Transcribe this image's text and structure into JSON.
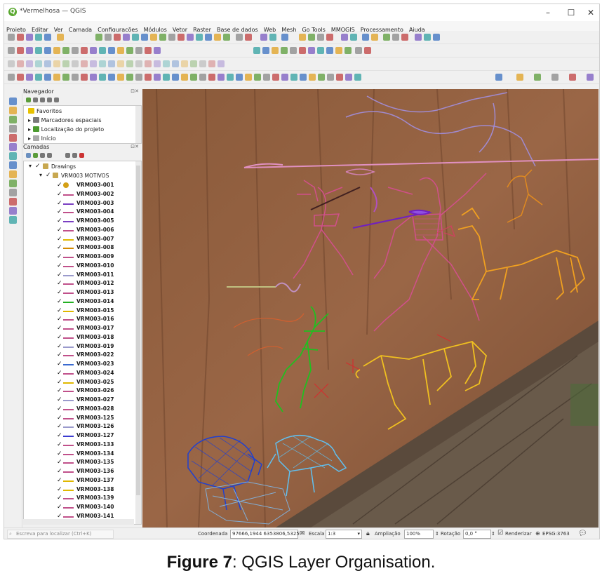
{
  "window": {
    "title": "*Vermelhosa — QGIS",
    "minimize": "–",
    "maximize": "☐",
    "close": "✕"
  },
  "menu": [
    "Projeto",
    "Editar",
    "Ver",
    "Camada",
    "Configurações",
    "Módulos",
    "Vetor",
    "Raster",
    "Base de dados",
    "Web",
    "Mesh",
    "Go Tools",
    "MMQGIS",
    "Processamento",
    "Ajuda"
  ],
  "navigator": {
    "title": "Navegador",
    "items": [
      "Favoritos",
      "Marcadores espaciais",
      "Localização do projeto",
      "Início"
    ]
  },
  "layers": {
    "title": "Camadas",
    "group": "Drawings",
    "subgroup": "VRM003 MOTIVOS",
    "items": [
      {
        "name": "VRM003-001",
        "color": "#d4a017"
      },
      {
        "name": "VRM003-002",
        "color": "#c0508a"
      },
      {
        "name": "VRM003-003",
        "color": "#7a3fc2"
      },
      {
        "name": "VRM003-004",
        "color": "#c0508a"
      },
      {
        "name": "VRM003-005",
        "color": "#7a3fc2"
      },
      {
        "name": "VRM003-006",
        "color": "#c0508a"
      },
      {
        "name": "VRM003-007",
        "color": "#e0b800"
      },
      {
        "name": "VRM003-008",
        "color": "#d48a00"
      },
      {
        "name": "VRM003-009",
        "color": "#c0508a"
      },
      {
        "name": "VRM003-010",
        "color": "#c0508a"
      },
      {
        "name": "VRM003-011",
        "color": "#9a9acc"
      },
      {
        "name": "VRM003-012",
        "color": "#c0508a"
      },
      {
        "name": "VRM003-013",
        "color": "#c0508a"
      },
      {
        "name": "VRM003-014",
        "color": "#22b022"
      },
      {
        "name": "VRM003-015",
        "color": "#e0b800"
      },
      {
        "name": "VRM003-016",
        "color": "#c0508a"
      },
      {
        "name": "VRM003-017",
        "color": "#c0508a"
      },
      {
        "name": "VRM003-018",
        "color": "#c0508a"
      },
      {
        "name": "VRM003-019",
        "color": "#9a9acc"
      },
      {
        "name": "VRM003-022",
        "color": "#c0508a"
      },
      {
        "name": "VRM003-023",
        "color": "#3a6ad0"
      },
      {
        "name": "VRM003-024",
        "color": "#c0508a"
      },
      {
        "name": "VRM003-025",
        "color": "#e0b800"
      },
      {
        "name": "VRM003-026",
        "color": "#c0508a"
      },
      {
        "name": "VRM003-027",
        "color": "#9a9acc"
      },
      {
        "name": "VRM003-028",
        "color": "#c0508a"
      },
      {
        "name": "VRM003-125",
        "color": "#c0508a"
      },
      {
        "name": "VRM003-126",
        "color": "#9a9acc"
      },
      {
        "name": "VRM003-127",
        "color": "#3a3ad0"
      },
      {
        "name": "VRM003-133",
        "color": "#c0508a"
      },
      {
        "name": "VRM003-134",
        "color": "#c0508a"
      },
      {
        "name": "VRM003-135",
        "color": "#c0508a"
      },
      {
        "name": "VRM003-136",
        "color": "#c0508a"
      },
      {
        "name": "VRM003-137",
        "color": "#e0b800"
      },
      {
        "name": "VRM003-138",
        "color": "#e0b800"
      },
      {
        "name": "VRM003-139",
        "color": "#c0508a"
      },
      {
        "name": "VRM003-140",
        "color": "#c0508a"
      },
      {
        "name": "VRM003-141",
        "color": "#c0508a"
      }
    ]
  },
  "status": {
    "search_placeholder": "Escreva para localizar (Ctrl+K)",
    "coord_label": "Coordenada",
    "coord_value": "97666,1944  6353806,5325",
    "scale_label": "Escala",
    "scale_value": "1:3",
    "magnifier_label": "Ampliação",
    "magnifier_value": "100%",
    "rotation_label": "Rotação",
    "rotation_value": "0,0 °",
    "render_label": "Renderizar",
    "crs": "EPSG:3763"
  },
  "caption": {
    "bold": "Figure 7",
    "rest": ": QGIS Layer Organisation."
  }
}
